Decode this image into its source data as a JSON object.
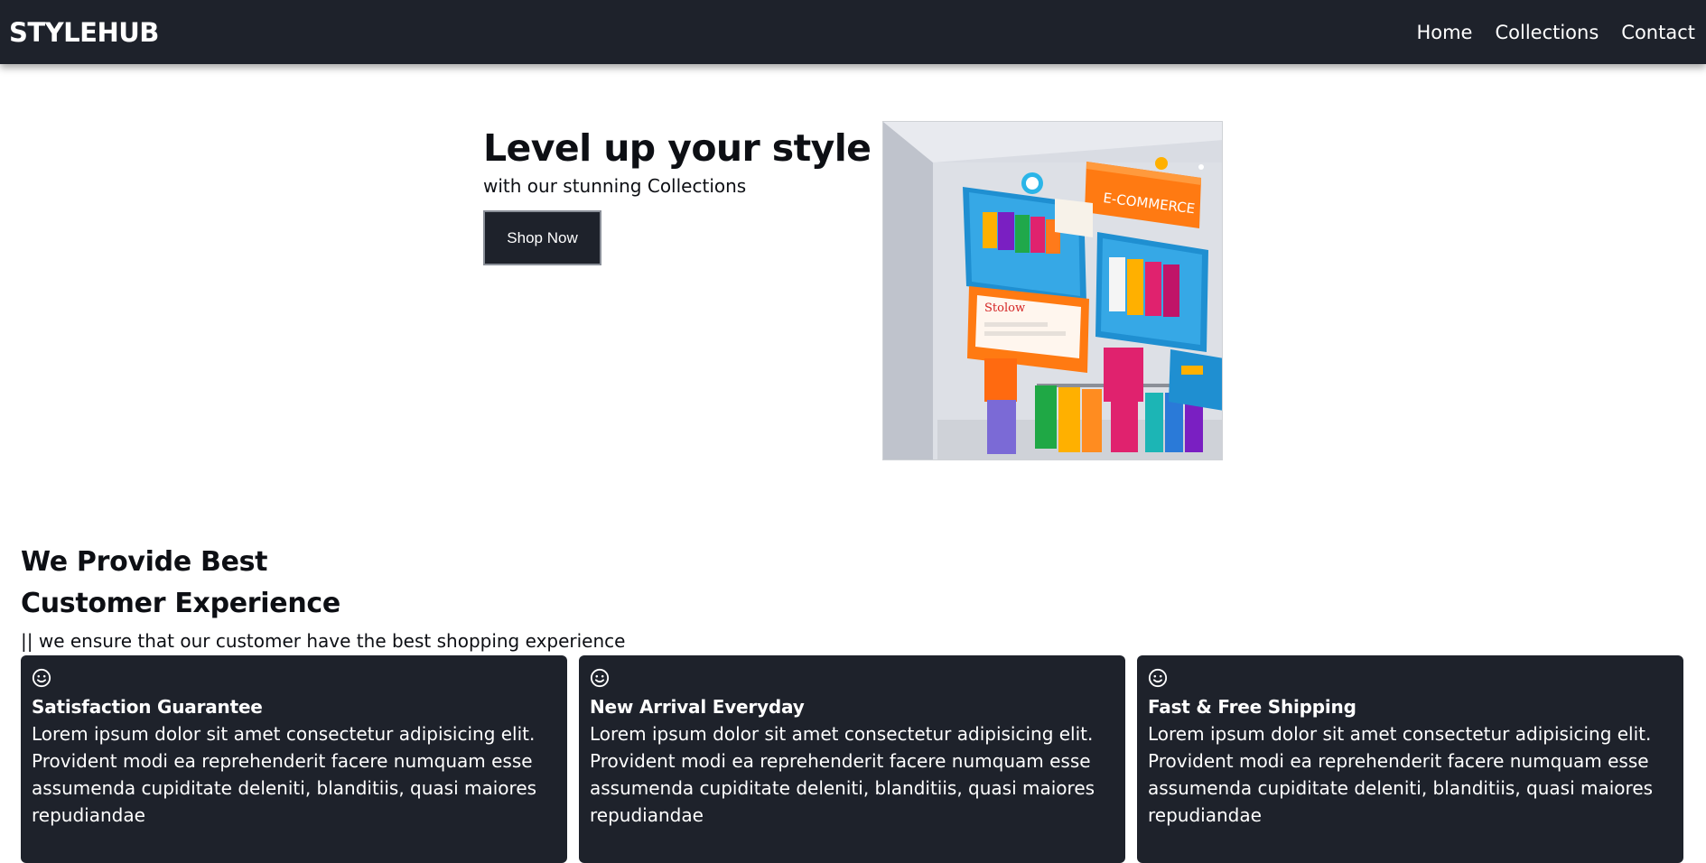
{
  "navbar": {
    "brand": "STYLEHUB",
    "links": [
      "Home",
      "Collections",
      "Contact"
    ]
  },
  "hero": {
    "title": "Level up your style",
    "subtitle": "with our stunning Collections",
    "cta_label": "Shop Now",
    "image": {
      "sign_text": "E-COMMERCE",
      "screen_text": "Stolow"
    }
  },
  "experience": {
    "heading_line1": "We Provide Best",
    "heading_line2": "Customer Experience",
    "subtitle": "|| we ensure that our customer have the best shopping experience",
    "cards": [
      {
        "icon": "smiley-icon",
        "title": "Satisfaction Guarantee",
        "body": "Lorem ipsum dolor sit amet consectetur adipisicing elit. Provident modi ea reprehenderit facere numquam esse assumenda cupiditate deleniti, blanditiis, quasi maiores repudiandae"
      },
      {
        "icon": "smiley-icon",
        "title": "New Arrival Everyday",
        "body": "Lorem ipsum dolor sit amet consectetur adipisicing elit. Provident modi ea reprehenderit facere numquam esse assumenda cupiditate deleniti, blanditiis, quasi maiores repudiandae"
      },
      {
        "icon": "smiley-icon",
        "title": "Fast & Free Shipping",
        "body": "Lorem ipsum dolor sit amet consectetur adipisicing elit. Provident modi ea reprehenderit facere numquam esse assumenda cupiditate deleniti, blanditiis, quasi maiores repudiandae"
      }
    ]
  },
  "colors": {
    "navbar_bg": "#1e222b",
    "text_dark": "#0d0f14",
    "card_bg": "#1e222b"
  }
}
